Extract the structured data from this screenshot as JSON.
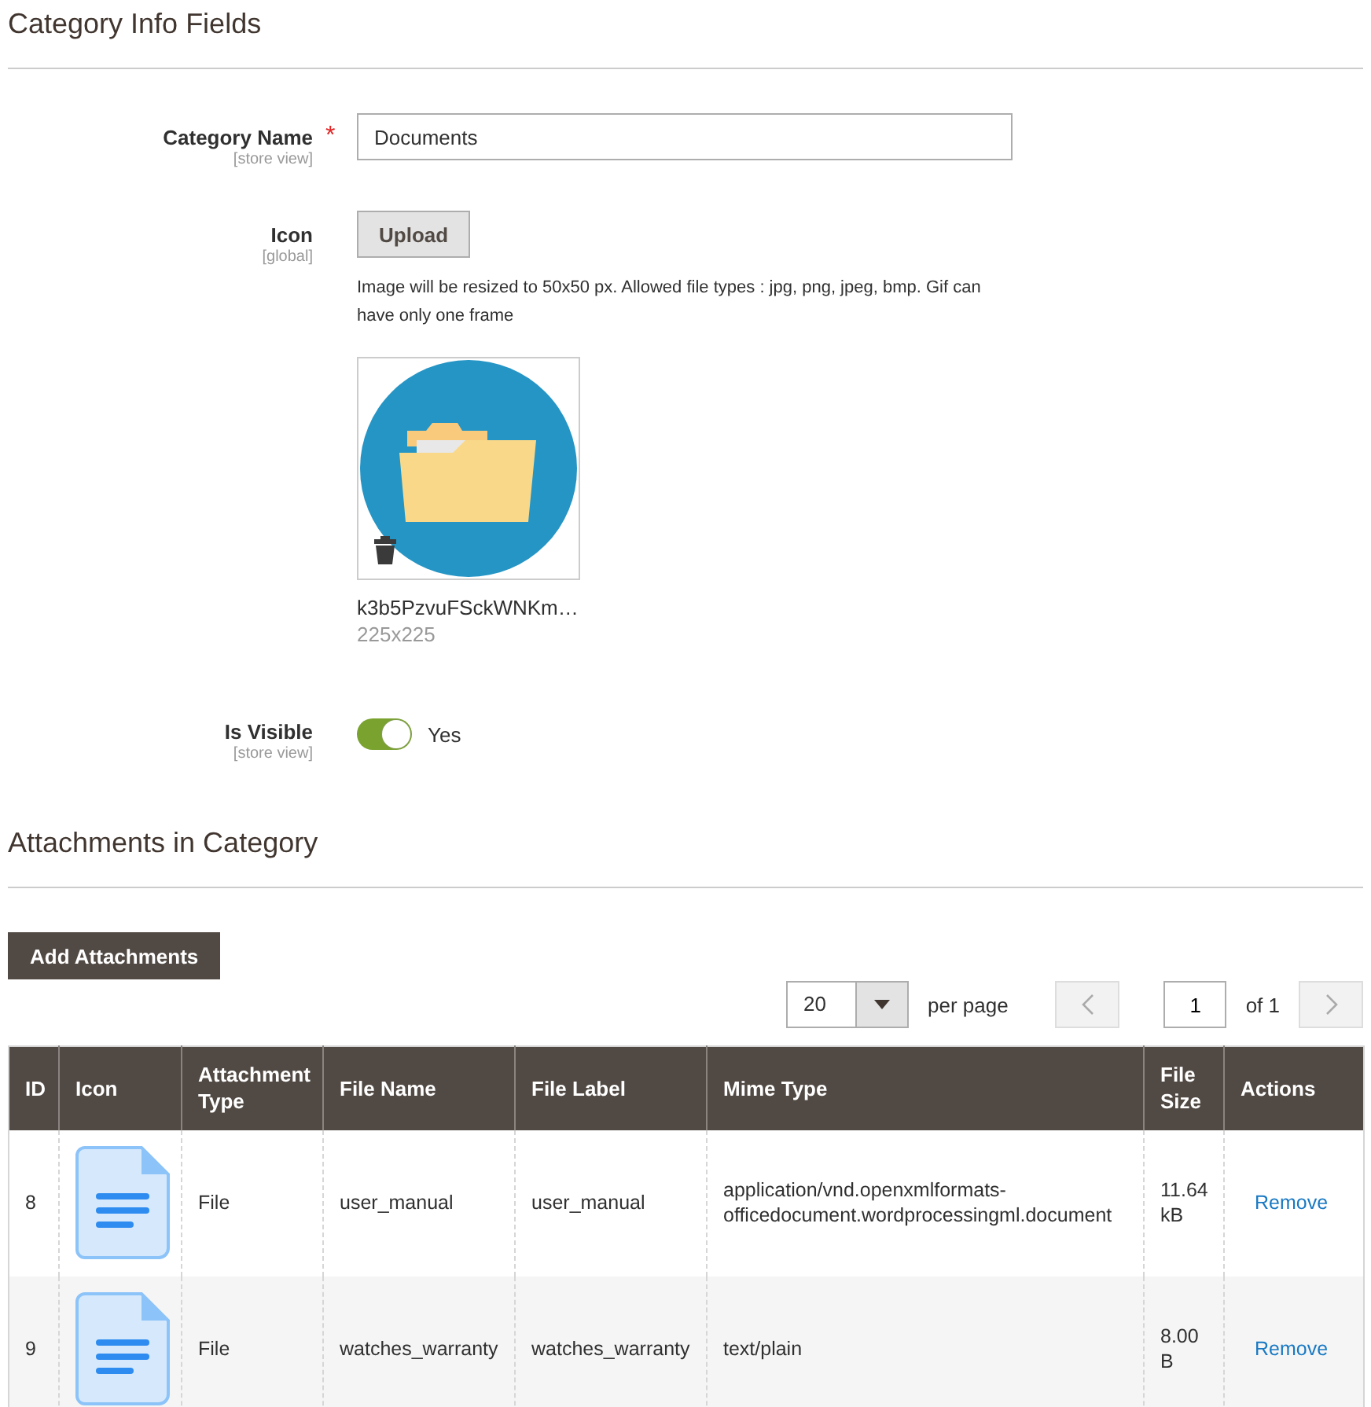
{
  "category_info": {
    "title": "Category Info Fields",
    "fields": [
      {
        "kind": "text",
        "label": "Category Name",
        "scope": "[store view]",
        "required_mark": "*",
        "value": "Documents"
      },
      {
        "kind": "image_upload",
        "label": "Icon",
        "scope": "[global]",
        "button": "Upload",
        "note": "Image will be resized to 50x50 px. Allowed file types : jpg, png, jpeg, bmp. Gif can have only one frame",
        "file_name": "k3b5PzvuFSckWNKm…",
        "dimensions": "225x225"
      },
      {
        "kind": "toggle",
        "label": "Is Visible",
        "scope": "[store view]",
        "on": true,
        "value_label": "Yes"
      }
    ]
  },
  "attachments": {
    "title": "Attachments in Category",
    "add_button": "Add Attachments",
    "pagination": {
      "per_page": "20",
      "per_page_label": "per page",
      "page": "1",
      "page_count": "of 1"
    },
    "table": {
      "columns": [
        "ID",
        "Icon",
        "Attachment Type",
        "File Name",
        "File Label",
        "Mime Type",
        "File Size",
        "Actions"
      ],
      "rows": [
        {
          "id": "8",
          "attachment_type": "File",
          "file_name": "user_manual",
          "file_label": "user_manual",
          "mime_type": "application/vnd.openxmlformats-officedocument.wordprocessingml.document",
          "file_size": "11.64 kB",
          "action": "Remove"
        },
        {
          "id": "9",
          "attachment_type": "File",
          "file_name": "watches_warranty",
          "file_label": "watches_warranty",
          "mime_type": "text/plain",
          "file_size": "8.00 B",
          "action": "Remove"
        }
      ]
    }
  }
}
